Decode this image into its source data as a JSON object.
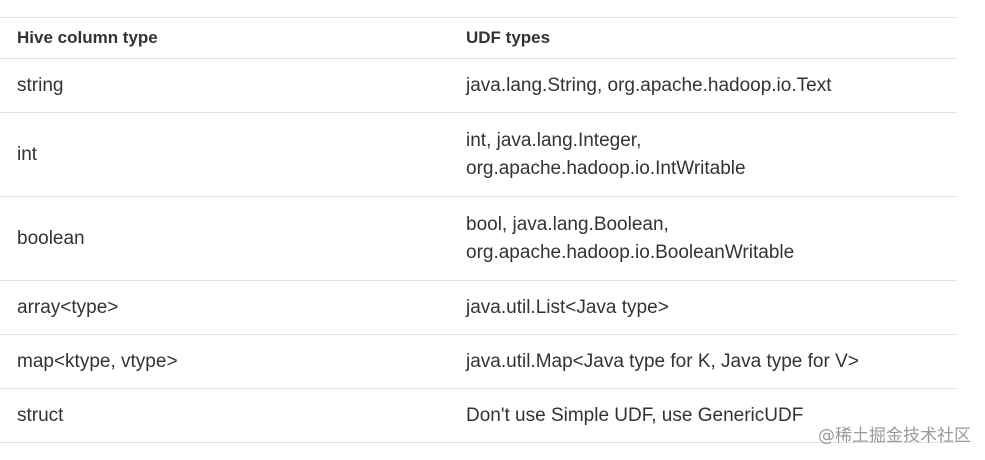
{
  "table": {
    "headers": [
      "Hive column type",
      "UDF types"
    ],
    "rows": [
      {
        "hive": "string",
        "udf": "java.lang.String, org.apache.hadoop.io.Text"
      },
      {
        "hive": "int",
        "udf_line1": "int, java.lang.Integer,",
        "udf_line2": "org.apache.hadoop.io.IntWritable"
      },
      {
        "hive": "boolean",
        "udf_line1": "bool, java.lang.Boolean,",
        "udf_line2": "org.apache.hadoop.io.BooleanWritable"
      },
      {
        "hive": "array<type>",
        "udf": "java.util.List<Java type>"
      },
      {
        "hive": "map<ktype, vtype>",
        "udf": "java.util.Map<Java type for K, Java type for V>"
      },
      {
        "hive": "struct",
        "udf": "Don't use Simple UDF, use GenericUDF"
      }
    ]
  },
  "watermark": "@稀土掘金技术社区"
}
